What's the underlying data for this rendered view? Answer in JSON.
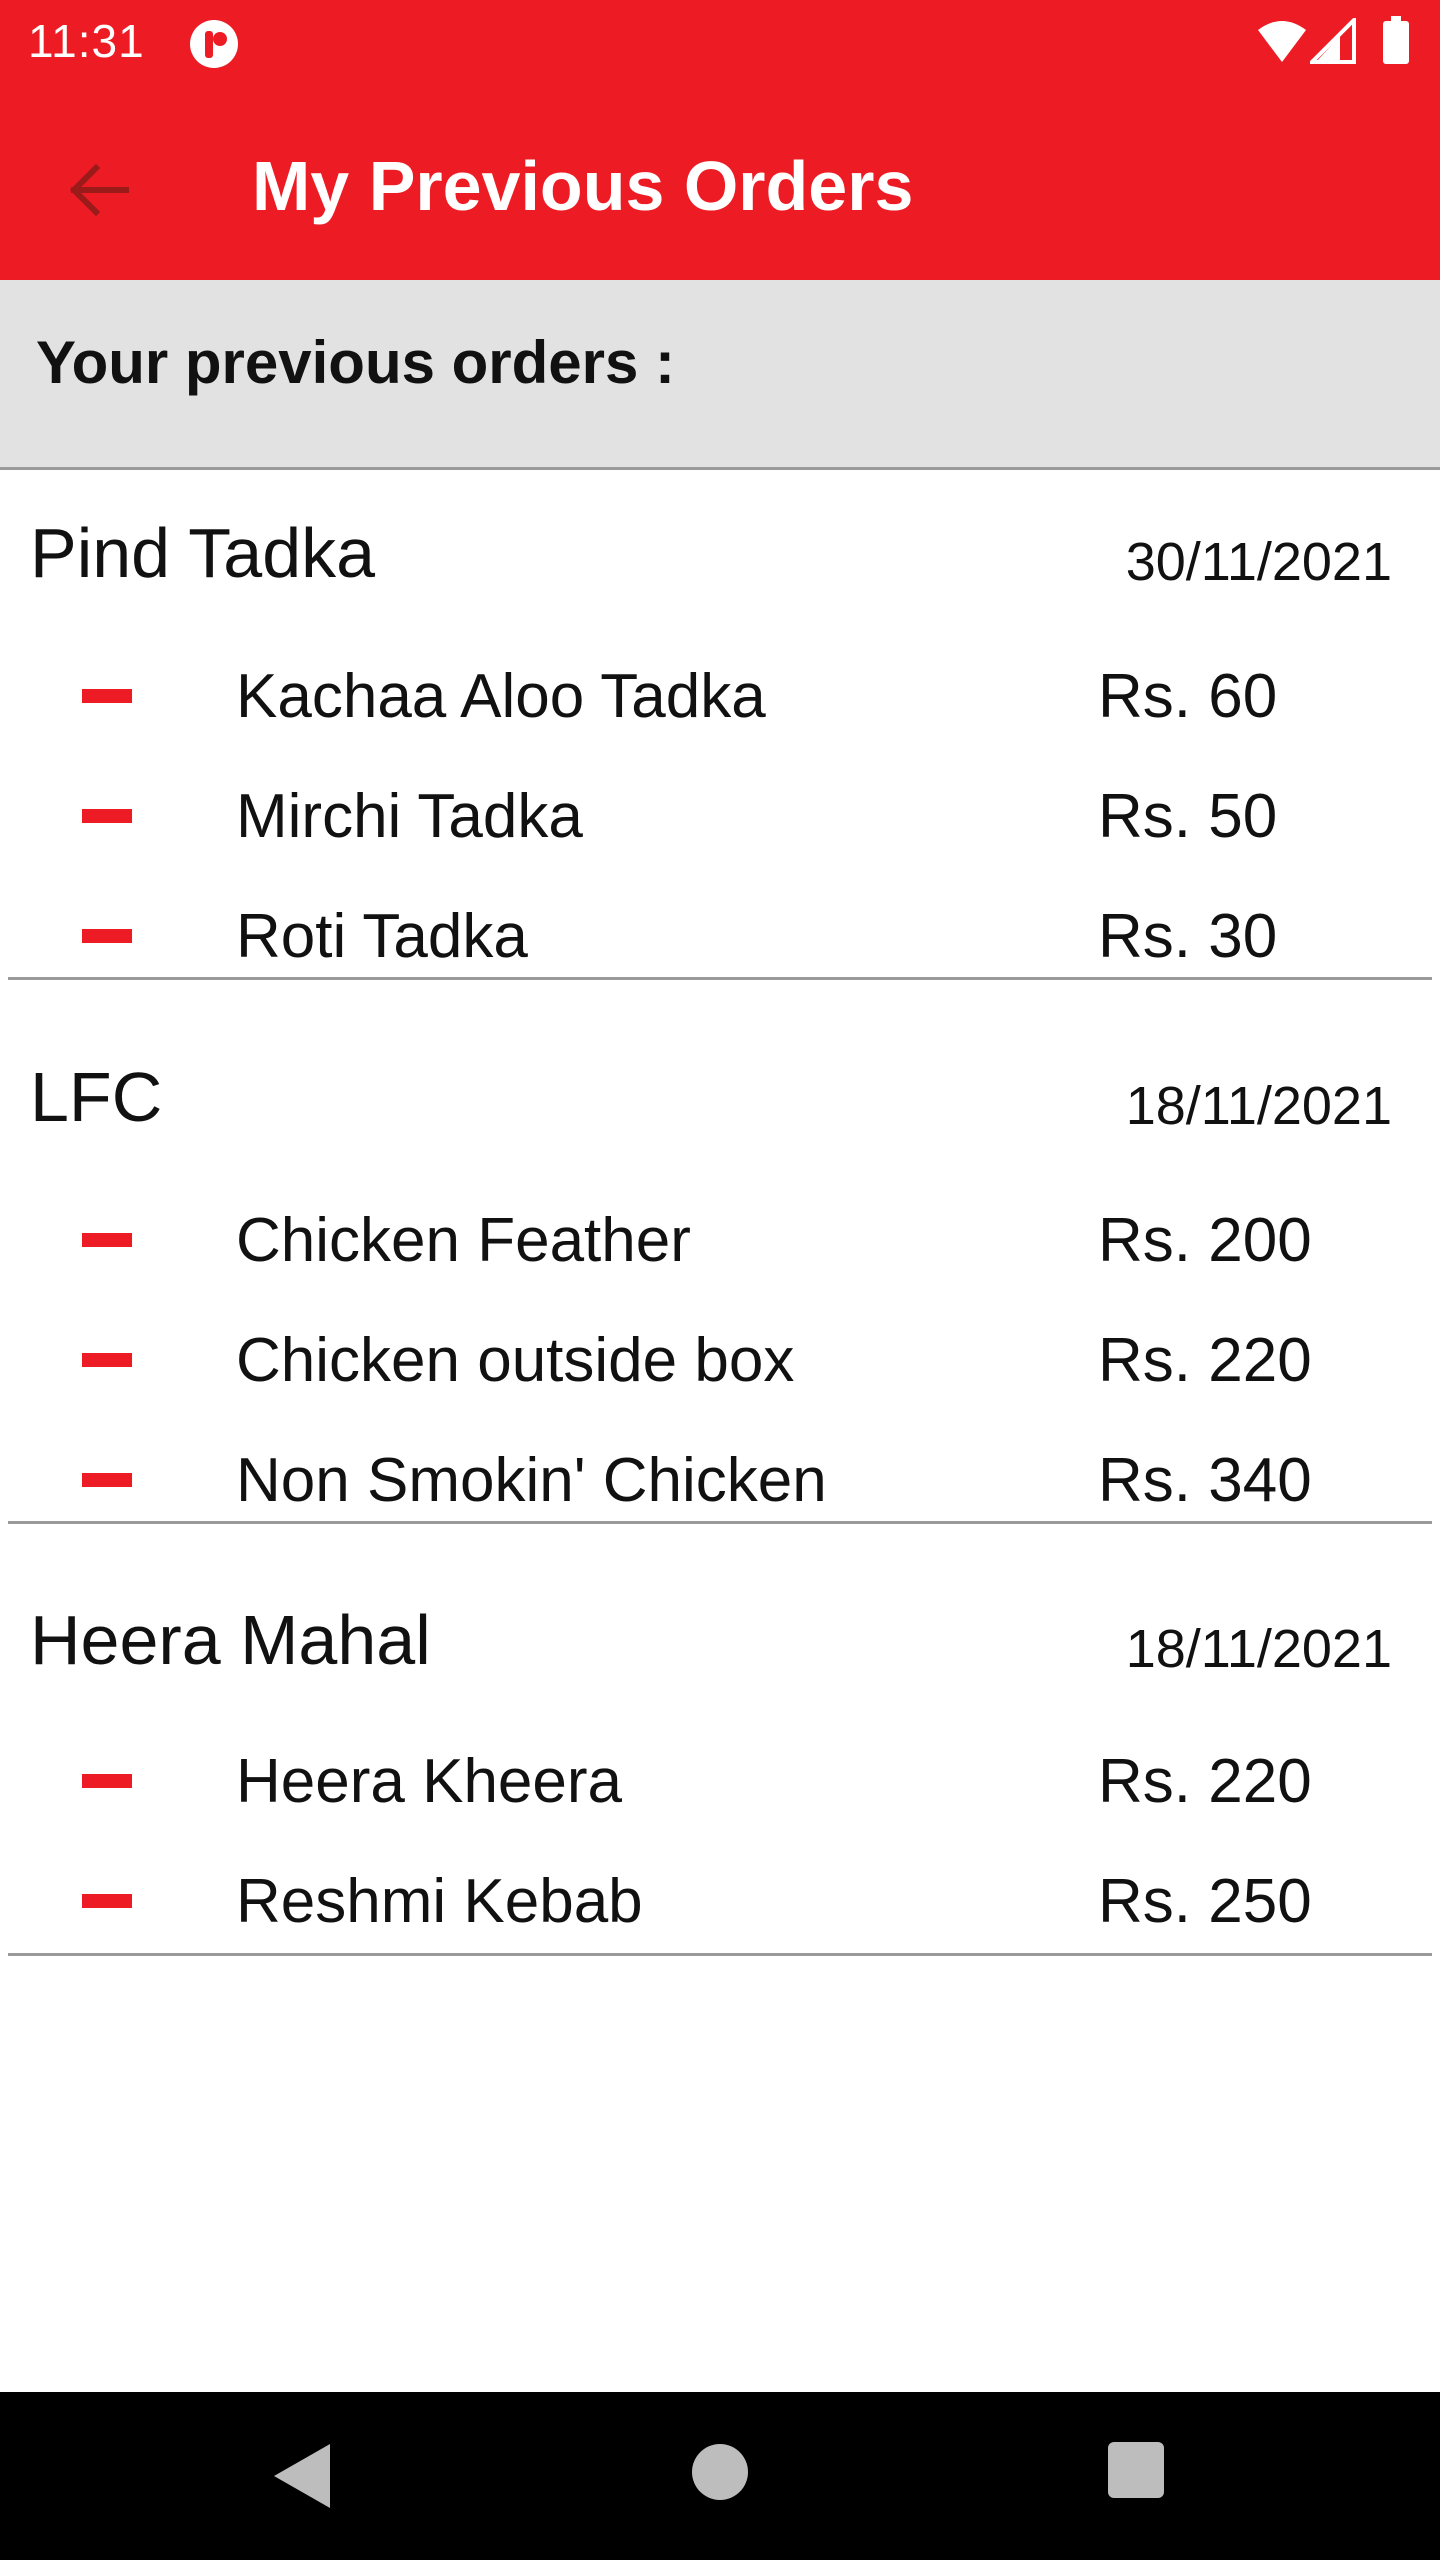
{
  "status_bar": {
    "time": "11:31",
    "icons": [
      "app-notification-icon",
      "wifi-icon",
      "cell-signal-icon",
      "battery-icon"
    ]
  },
  "app_bar": {
    "title": "My Previous Orders",
    "back_icon": "arrow-back-icon",
    "background_color": "#ED1C24"
  },
  "section_header": {
    "text": "Your previous orders :"
  },
  "orders": [
    {
      "restaurant": "Pind Tadka",
      "date": "30/11/2021",
      "items": [
        {
          "name": "Kachaa Aloo Tadka",
          "price": "Rs. 60"
        },
        {
          "name": "Mirchi Tadka",
          "price": "Rs. 50"
        },
        {
          "name": "Roti Tadka",
          "price": "Rs. 30"
        }
      ]
    },
    {
      "restaurant": "LFC",
      "date": "18/11/2021",
      "items": [
        {
          "name": "Chicken Feather",
          "price": "Rs. 200"
        },
        {
          "name": "Chicken outside box",
          "price": "Rs. 220"
        },
        {
          "name": "Non Smokin' Chicken",
          "price": "Rs. 340"
        }
      ]
    },
    {
      "restaurant": "Heera Mahal",
      "date": "18/11/2021",
      "items": [
        {
          "name": "Heera Kheera",
          "price": "Rs. 220"
        },
        {
          "name": "Reshmi Kebab",
          "price": "Rs. 250"
        }
      ]
    }
  ],
  "nav_bar": {
    "icons": [
      "nav-back-icon",
      "nav-home-icon",
      "nav-recents-icon"
    ]
  },
  "colors": {
    "accent": "#ED1C24",
    "header_gray": "#e2e2e2",
    "divider": "#9a9a9a"
  }
}
